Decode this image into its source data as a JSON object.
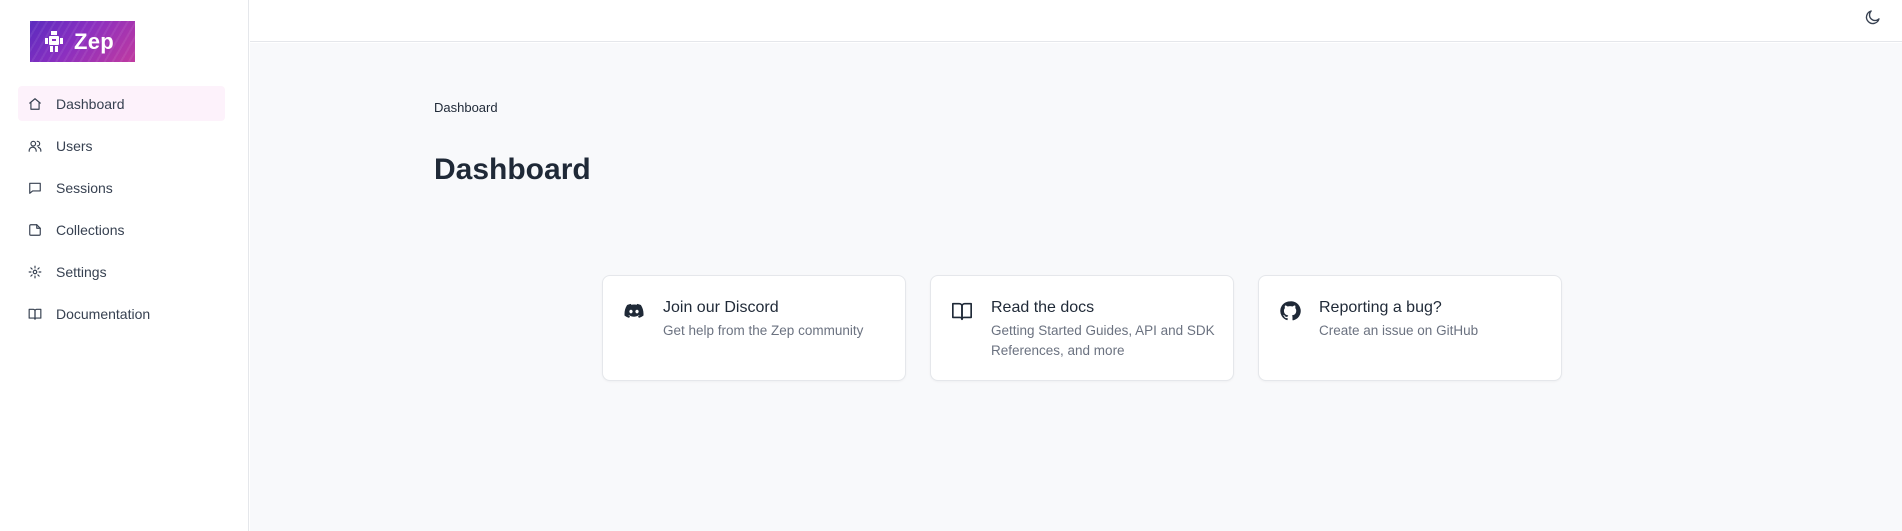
{
  "brand": {
    "name": "Zep"
  },
  "sidebar": {
    "items": [
      {
        "label": "Dashboard",
        "icon": "home-icon",
        "active": true
      },
      {
        "label": "Users",
        "icon": "users-icon",
        "active": false
      },
      {
        "label": "Sessions",
        "icon": "message-square-icon",
        "active": false
      },
      {
        "label": "Collections",
        "icon": "sticky-note-icon",
        "active": false
      },
      {
        "label": "Settings",
        "icon": "gear-icon",
        "active": false
      },
      {
        "label": "Documentation",
        "icon": "book-open-icon",
        "active": false
      }
    ]
  },
  "topbar": {
    "theme_toggle_icon": "moon-icon"
  },
  "main": {
    "breadcrumb": "Dashboard",
    "title": "Dashboard",
    "cards": [
      {
        "title": "Join our Discord",
        "description": "Get help from the Zep community",
        "icon": "discord-icon"
      },
      {
        "title": "Read the docs",
        "description": "Getting Started Guides, API and SDK References, and more",
        "icon": "book-open-icon"
      },
      {
        "title": "Reporting a bug?",
        "description": "Create an issue on GitHub",
        "icon": "github-icon"
      }
    ]
  },
  "colors": {
    "accent_active_bg": "#fdf2fb",
    "logo_gradient_start": "#5b2bbf",
    "logo_gradient_end": "#c03aa0",
    "main_bg": "#f8f9fb"
  }
}
